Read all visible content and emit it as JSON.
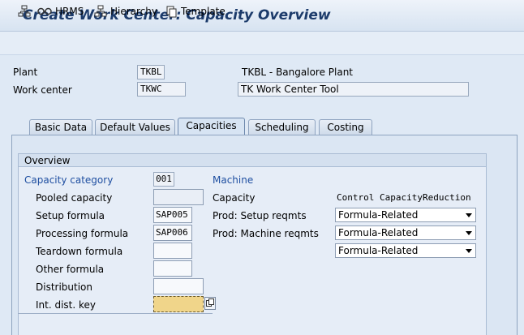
{
  "window": {
    "title": "Create Work Center: Capacity Overview"
  },
  "toolbar": {
    "items": [
      {
        "label": "",
        "icon": "org-tree-icon"
      },
      {
        "label": "HRMS",
        "icon": "glasses-icon"
      },
      {
        "label": "Hierarchy",
        "icon": "hierarchy-icon"
      },
      {
        "label": "Template",
        "icon": "copy-icon"
      }
    ]
  },
  "header": {
    "plant_label": "Plant",
    "plant_value": "TKBL",
    "plant_desc": "TKBL - Bangalore Plant",
    "workcenter_label": "Work center",
    "workcenter_value": "TKWC",
    "workcenter_desc": "TK Work Center Tool"
  },
  "tabs": [
    {
      "label": "Basic Data",
      "active": false
    },
    {
      "label": "Default Values",
      "active": false
    },
    {
      "label": "Capacities",
      "active": true
    },
    {
      "label": "Scheduling",
      "active": false
    },
    {
      "label": "Costing",
      "active": false
    }
  ],
  "overview": {
    "title": "Overview",
    "capacity_category_label": "Capacity category",
    "capacity_category_value": "001",
    "capacity_category_desc": "Machine",
    "pooled_capacity_label": "Pooled capacity",
    "pooled_capacity_value": "",
    "setup_formula_label": "Setup formula",
    "setup_formula_value": "SAP005",
    "processing_formula_label": "Processing formula",
    "processing_formula_value": "SAP006",
    "teardown_formula_label": "Teardown formula",
    "teardown_formula_value": "",
    "other_formula_label": "Other formula",
    "other_formula_value": "",
    "distribution_label": "Distribution",
    "distribution_value": "",
    "int_dist_key_label": "Int. dist. key",
    "int_dist_key_value": "",
    "capacity_label": "Capacity",
    "control_header": "Control CapacityReduction",
    "prod_setup_label": "Prod: Setup reqmts",
    "prod_machine_label": "Prod: Machine reqmts",
    "reduction_1": "Formula-Related",
    "reduction_2": "Formula-Related",
    "reduction_3": "Formula-Related"
  },
  "colors": {
    "title": "#1c3b6b",
    "link_blue": "#1f4fa1",
    "focus_field": "#f0d58a"
  }
}
